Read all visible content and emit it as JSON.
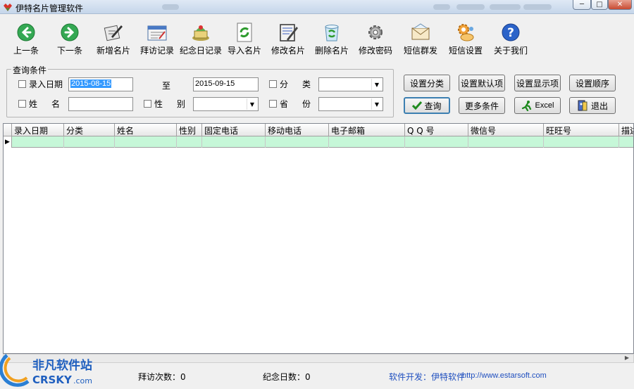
{
  "window": {
    "title": "伊特名片管理软件",
    "min": "─",
    "max": "□",
    "close": "✕"
  },
  "toolbar": [
    {
      "label": "上一条",
      "icon": "left-arrow-icon"
    },
    {
      "label": "下一条",
      "icon": "right-arrow-icon"
    },
    {
      "label": "新增名片",
      "icon": "new-card-icon"
    },
    {
      "label": "拜访记录",
      "icon": "visit-record-icon"
    },
    {
      "label": "纪念日记录",
      "icon": "anniversary-icon"
    },
    {
      "label": "导入名片",
      "icon": "import-icon"
    },
    {
      "label": "修改名片",
      "icon": "edit-card-icon"
    },
    {
      "label": "删除名片",
      "icon": "recycle-bin-icon"
    },
    {
      "label": "修改密码",
      "icon": "gear-icon"
    },
    {
      "label": "短信群发",
      "icon": "envelope-icon"
    },
    {
      "label": "短信设置",
      "icon": "sms-settings-icon"
    },
    {
      "label": "关于我们",
      "icon": "help-icon"
    }
  ],
  "query": {
    "legend": "查询条件",
    "entry_date_label": "录入日期",
    "date_from": "2015-08-15",
    "to_label": "至",
    "date_to": "2015-09-15",
    "category_label_1": "分",
    "category_label_2": "类",
    "name_label_1": "姓",
    "name_label_2": "名",
    "gender_label_1": "性",
    "gender_label_2": "别",
    "province_label_1": "省",
    "province_label_2": "份"
  },
  "buttons": {
    "set_category": "设置分类",
    "set_default": "设置默认项",
    "set_display": "设置显示项",
    "set_order": "设置顺序",
    "query": "查询",
    "more": "更多条件",
    "excel": "Excel",
    "exit": "退出"
  },
  "table": {
    "columns": [
      "录入日期",
      "分类",
      "姓名",
      "性别",
      "固定电话",
      "移动电话",
      "电子邮箱",
      "Q Q 号",
      "微信号",
      "旺旺号",
      "描述"
    ]
  },
  "status": {
    "visits": "拜访次数：0",
    "anniversaries": "纪念日数：0",
    "developer": "软件开发：伊特软件",
    "url": "http://www.estarsoft.com"
  },
  "watermark": {
    "text_cn": "非凡软件站",
    "text_en": "CRSKY",
    "text_suffix": ".com"
  },
  "colors": {
    "row_highlight": "#c6f7d8",
    "link_blue": "#1f4fbf",
    "selection": "#3399ff"
  }
}
